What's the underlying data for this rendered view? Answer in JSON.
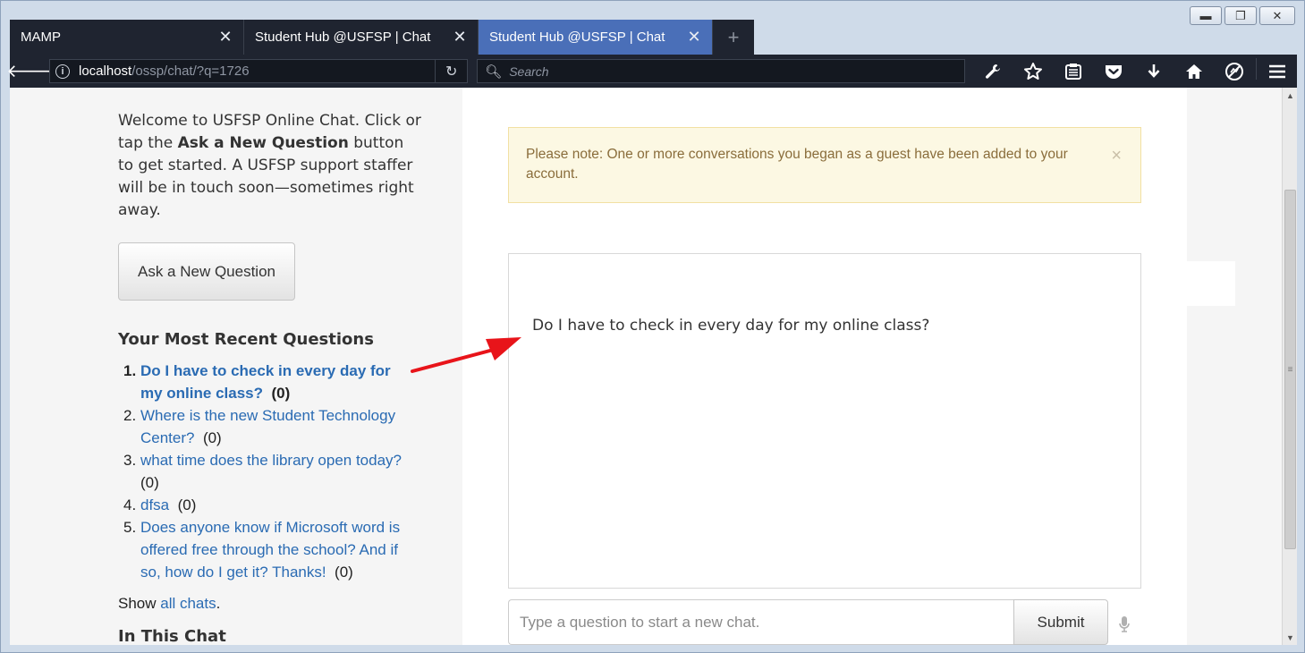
{
  "window": {
    "minimize": "▬",
    "restore": "❐",
    "close": "✕"
  },
  "tabs": [
    {
      "title": "MAMP",
      "close": "✕"
    },
    {
      "title": "Student Hub @USFSP | Chat",
      "close": "✕"
    },
    {
      "title": "Student Hub @USFSP | Chat",
      "close": "✕"
    }
  ],
  "new_tab": "+",
  "nav": {
    "back_icon": "arrow-left-icon",
    "url_host": "localhost",
    "url_path": "/ossp/chat/?q=1726",
    "search_placeholder": "Search"
  },
  "toolbar_icons": [
    "wrench-icon",
    "star-icon",
    "reading-list-icon",
    "pocket-icon",
    "download-icon",
    "home-icon",
    "no-script-icon",
    "menu-icon"
  ],
  "sidebar": {
    "welcome_pre": "Welcome to USFSP Online Chat. Click or tap the ",
    "welcome_bold": "Ask a New Question",
    "welcome_post": " button to get started. A USFSP support staffer will be in touch soon—sometimes right away.",
    "ask_button": "Ask a New Question",
    "recent_title": "Your Most Recent Questions",
    "questions": [
      {
        "num": "1.",
        "text": "Do I have to check in every day for my online class?",
        "count": "(0)"
      },
      {
        "num": "2.",
        "text": "Where is the new Student Technology Center?",
        "count": "(0)"
      },
      {
        "num": "3.",
        "text": "what time does the library open today?",
        "count": "(0)"
      },
      {
        "num": "4.",
        "text": "dfsa",
        "count": "(0)"
      },
      {
        "num": "5.",
        "text": "Does anyone know if Microsoft word is offered free through the school? And if so, how do I get it? Thanks!",
        "count": "(0)"
      }
    ],
    "show_pre": "Show ",
    "show_link": "all chats",
    "show_post": ".",
    "in_this_chat": "In This Chat"
  },
  "alert": {
    "text": "Please note: One or more conversations you began as a guest have been added to your account.",
    "close": "×"
  },
  "chat": {
    "message": "Do I have to check in every day for my online class?"
  },
  "input": {
    "placeholder": "Type a question to start a new chat.",
    "value": "",
    "submit": "Submit"
  },
  "colors": {
    "tab_active": "#4a6fb8",
    "toolbar_bg": "#1f2430",
    "link": "#2a6bb3",
    "alert_bg": "#fcf8e3",
    "alert_text": "#8a6d3b",
    "arrow": "#e8141a"
  }
}
